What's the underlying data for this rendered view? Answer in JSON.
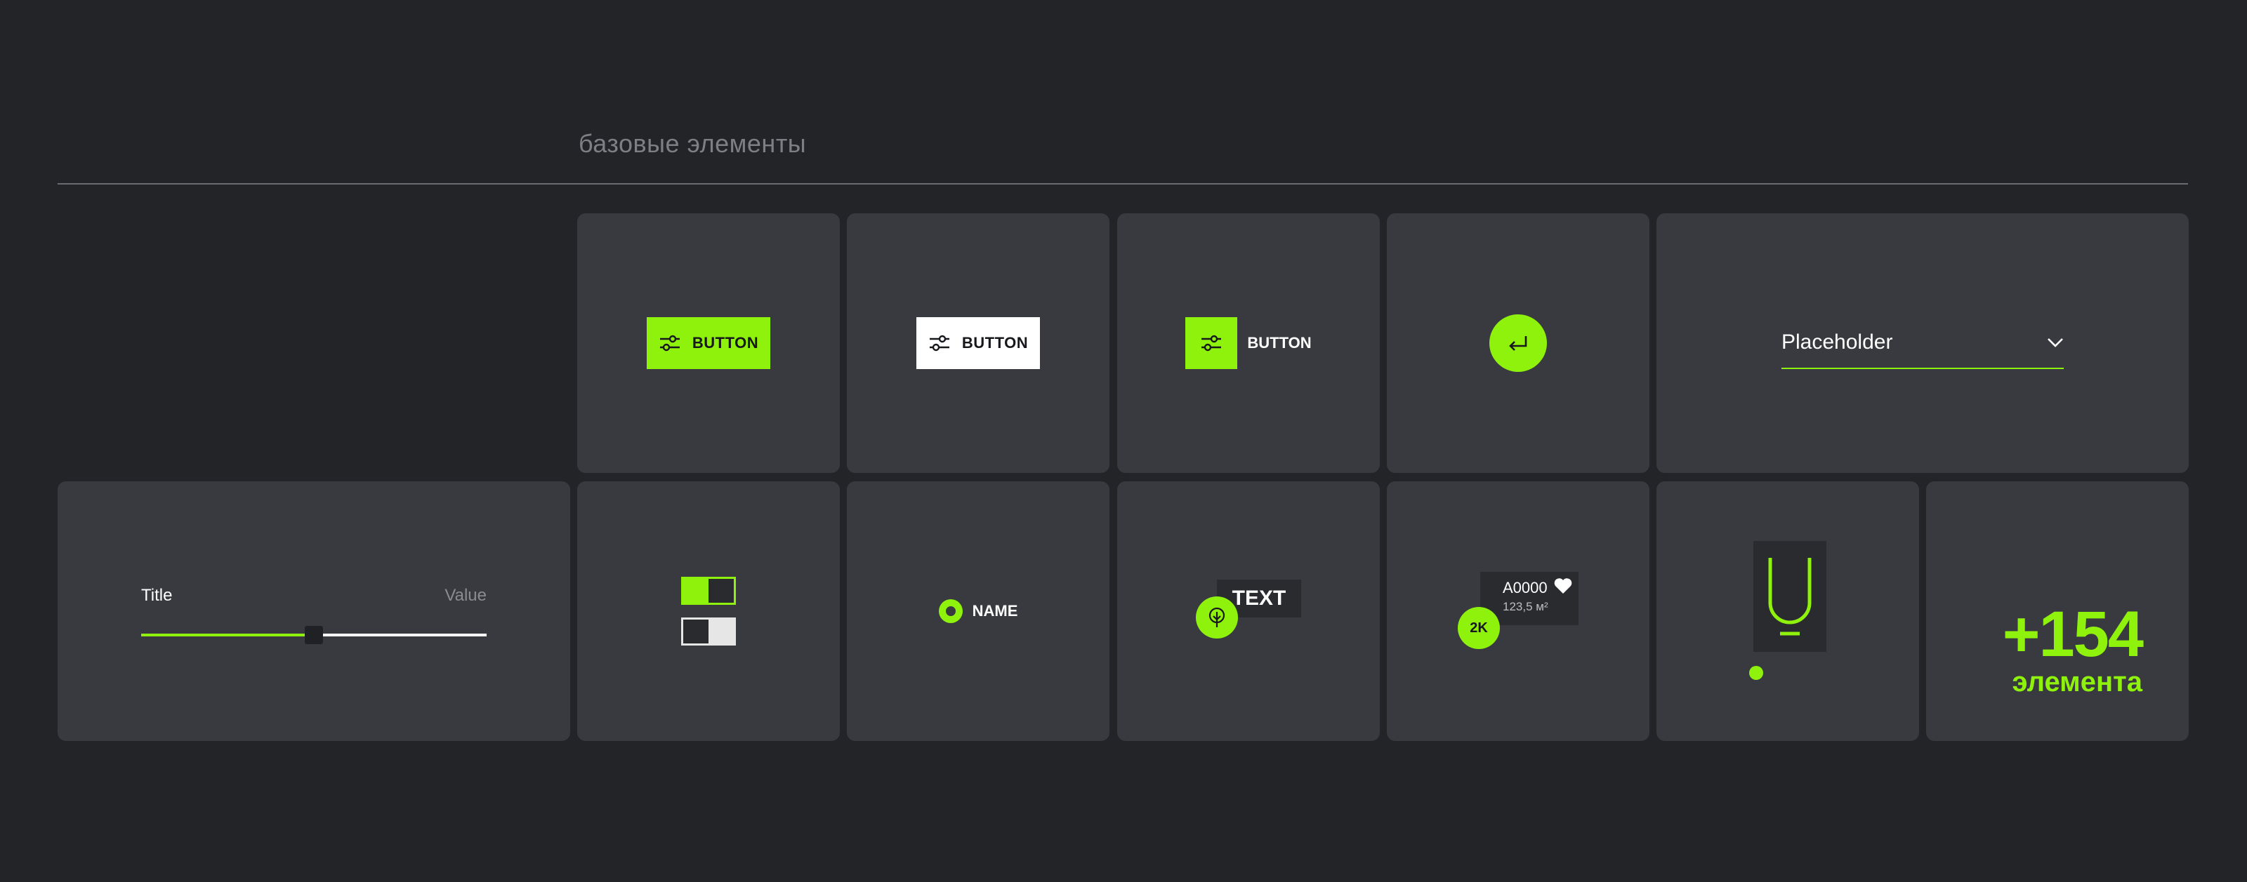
{
  "section": {
    "title": "базовые элементы"
  },
  "buttons": {
    "primary_label": "BUTTON",
    "secondary_label": "BUTTON",
    "icon_label": "BUTTON"
  },
  "select": {
    "placeholder": "Placeholder"
  },
  "slider": {
    "title": "Title",
    "value_label": "Value",
    "fill_percent": 50
  },
  "radio": {
    "label": "NAME"
  },
  "map_marker": {
    "label": "TEXT"
  },
  "listing": {
    "code": "A0000",
    "area": "123,5 м²",
    "count": "2K"
  },
  "more": {
    "count": "+154",
    "label": "элемента"
  },
  "colors": {
    "accent": "#8ff20c",
    "background": "#232428",
    "card": "#393a3f",
    "dark": "#2a2b2f"
  }
}
